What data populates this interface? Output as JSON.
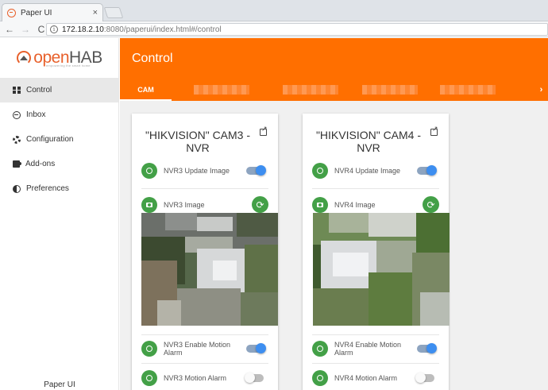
{
  "browser": {
    "tab_title": "Paper UI",
    "tab_close": "×",
    "url_host": "172.18.2.10",
    "url_rest": ":8080/paperui/index.html#/control",
    "back": "←",
    "forward": "→",
    "reload": "C",
    "info": "i"
  },
  "app": {
    "logo_open": "open",
    "logo_hab": "HAB",
    "logo_tagline": "empowering the smart home",
    "page_title": "Control",
    "footer": "Paper UI"
  },
  "sidebar": {
    "items": [
      {
        "label": "Control",
        "icon": "dashboard-icon"
      },
      {
        "label": "Inbox",
        "icon": "inbox-icon"
      },
      {
        "label": "Configuration",
        "icon": "gear-icon"
      },
      {
        "label": "Add-ons",
        "icon": "puzzle-icon"
      },
      {
        "label": "Preferences",
        "icon": "preferences-icon"
      }
    ]
  },
  "tabs": {
    "active": "CAM",
    "more": "›"
  },
  "cards": [
    {
      "title_line1": "\"HIKVISION\" CAM3 -",
      "title_line2": "NVR",
      "update_label": "NVR3 Update Image",
      "update_on": true,
      "image_label": "NVR3 Image",
      "motion_enable_label": "NVR3 Enable Motion Alarm",
      "motion_enable_on": true,
      "motion_alarm_label": "NVR3 Motion Alarm",
      "motion_alarm_on": false
    },
    {
      "title_line1": "\"HIKVISION\" CAM4 -",
      "title_line2": "NVR",
      "update_label": "NVR4 Update Image",
      "update_on": true,
      "image_label": "NVR4 Image",
      "motion_enable_label": "NVR4 Enable Motion Alarm",
      "motion_enable_on": true,
      "motion_alarm_label": "NVR4 Motion Alarm",
      "motion_alarm_on": false
    }
  ],
  "colors": {
    "brand": "#ff6f00",
    "accent_green": "#43a047",
    "toggle_blue": "#3d8ef0"
  },
  "icons": {
    "refresh": "⟳"
  }
}
